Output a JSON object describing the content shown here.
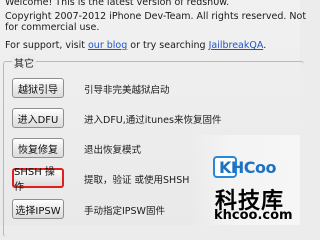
{
  "header": {
    "welcome_line": "Welcome! This is the latest version of redsn0w.",
    "copyright_line_1": "Copyright 2007-2012 iPhone Dev-Team. All rights reserved. Not",
    "copyright_line_2": "for commercial use.",
    "support_prefix": "For support, visit ",
    "support_blog_link": "our blog",
    "support_middle": " or try searching ",
    "support_search_link": "JailbreakQA",
    "support_suffix": "."
  },
  "group": {
    "legend": "其它"
  },
  "buttons": [
    {
      "label": "越狱引导",
      "description": "引导非完美越狱启动"
    },
    {
      "label": "进入DFU",
      "description": "进入DFU,通过itunes来恢复固件"
    },
    {
      "label": "恢复修复",
      "description": "退出恢复模式"
    },
    {
      "label": "SHSH 操作",
      "description": "提取，验证 或使用SHSH"
    },
    {
      "label": "选择IPSW",
      "description": "手动指定IPSW固件"
    }
  ],
  "watermark": {
    "logo_text": "KHCoo",
    "name_cn": "科技库",
    "url": "khcoo.com"
  },
  "colors": {
    "link": "#1f55c9",
    "highlight_border": "#e0201f",
    "watermark_blue": "#1d72c2"
  }
}
